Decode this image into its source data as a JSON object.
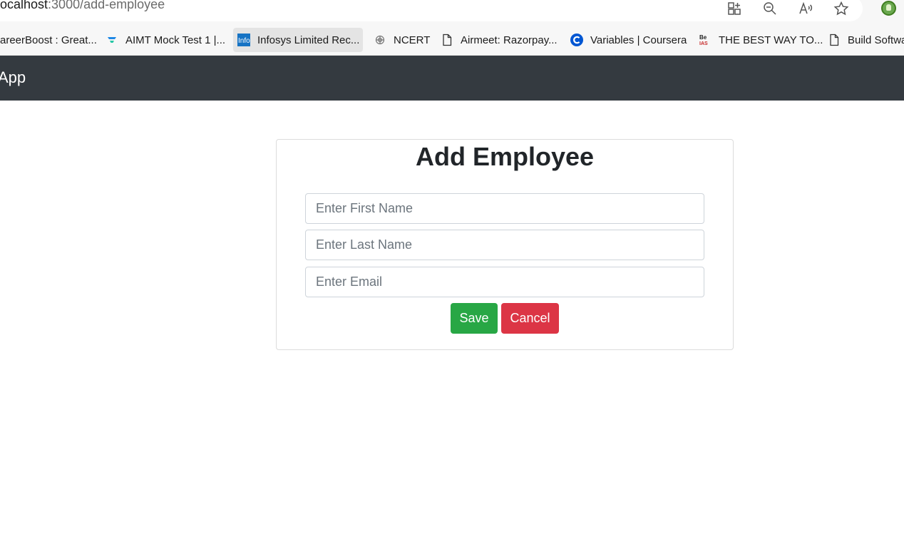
{
  "browser": {
    "url_host": "ocalhost",
    "url_path": ":3000/add-employee",
    "toolbar_icons": [
      "app-grid-icon",
      "zoom-out-icon",
      "read-aloud-icon",
      "favorite-star-icon",
      "profile-avatar-icon"
    ],
    "bookmarks": [
      {
        "label": "areerBoost : Great...",
        "icon": "none"
      },
      {
        "label": "AIMT Mock Test 1 |...",
        "icon": "aimt-icon"
      },
      {
        "label": "Infosys Limited Rec...",
        "icon": "infosys-icon"
      },
      {
        "label": "NCERT",
        "icon": "ncert-icon"
      },
      {
        "label": "Airmeet: Razorpay...",
        "icon": "page-icon"
      },
      {
        "label": "Variables | Coursera",
        "icon": "coursera-icon"
      },
      {
        "label": "THE BEST WAY TO...",
        "icon": "beias-icon"
      },
      {
        "label": "Build Softwa",
        "icon": "page-icon"
      }
    ]
  },
  "navbar": {
    "brand": "t App"
  },
  "form": {
    "title": "Add Employee",
    "first_name_placeholder": "Enter First Name",
    "last_name_placeholder": "Enter Last Name",
    "email_placeholder": "Enter Email",
    "save_label": "Save",
    "cancel_label": "Cancel"
  },
  "colors": {
    "navbar_bg": "#343a40",
    "save_button": "#28a745",
    "cancel_button": "#dc3545"
  }
}
